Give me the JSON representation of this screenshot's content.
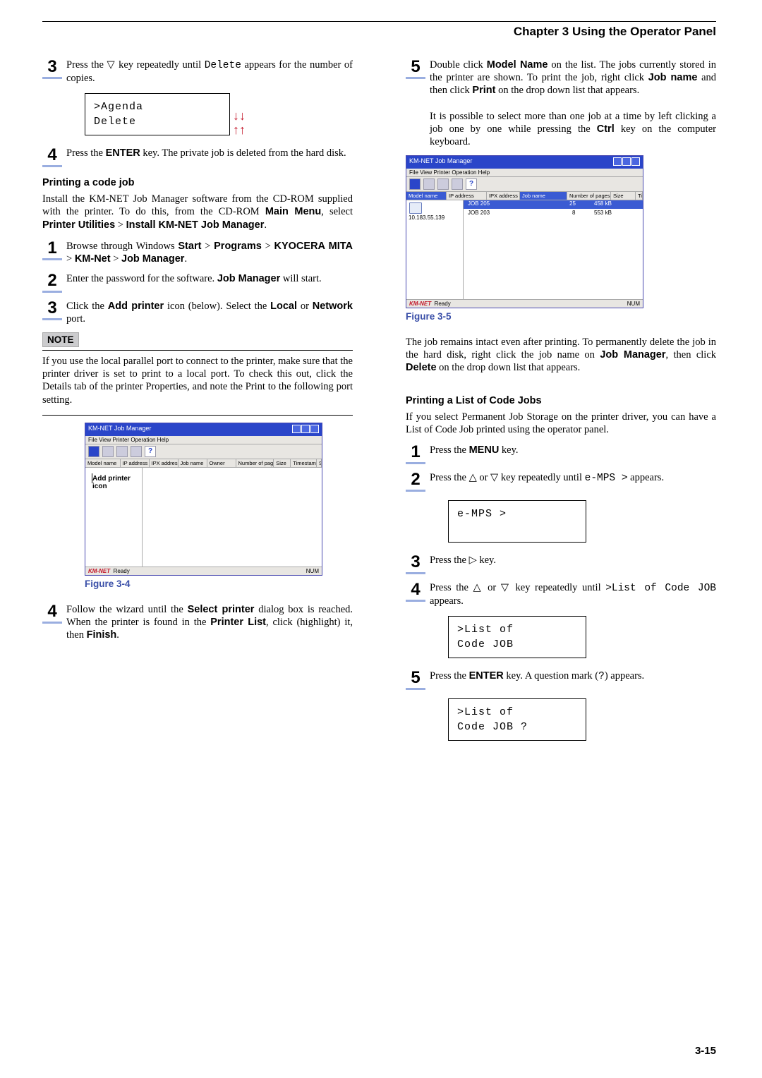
{
  "chapterTitle": "Chapter 3  Using the Operator Panel",
  "left": {
    "step3": "Press the ▽ key repeatedly until Delete appears for the number of copies.",
    "lcd3_line1": ">Agenda",
    "lcd3_line2": " Delete",
    "step4": "Press the ENTER key. The private job is deleted from the hard disk.",
    "sec_printingCodeJob": "Printing a code job",
    "para_install_full": "Install the KM-NET Job Manager software from the CD-ROM supplied with the printer. To do this, from the CD-ROM Main Menu, select Printer Utilities > Install KM-NET Job Manager.",
    "step1b_full": "Browse through Windows Start > Programs > KYOCERA MITA > KM-Net > Job Manager.",
    "step2b_full": "Enter the password for the software. Job Manager will start.",
    "step3b_full": "Click the Add printer icon (below). Select the Local or Network port.",
    "noteLabel": "NOTE",
    "noteBody": "If you use the local parallel port to connect to the printer, make sure that the printer driver is set to print to a local port. To check this out, click the Details tab of the printer Properties, and note the Print to the following port setting.",
    "figure34": "Figure 3-4",
    "step4b_full": "Follow the wizard until the Select printer dialog box is reached. When the printer is found in the Printer List, click (highlight) it, then Finish."
  },
  "right": {
    "step5_full": "Double click Model Name on the list. The jobs currently stored in the printer are shown. To print the job, right click Job name and then click Print on the drop down list that appears.",
    "step5_extra_full": "It is possible to select more than one job at a time by left clicking a job one by one while pressing the Ctrl key on the computer keyboard.",
    "figure35": "Figure 3-5",
    "after_fig_full": "The job remains intact even after printing. To permanently delete the job in the hard disk, right click the job name on Job Manager, then click Delete on the drop down list that appears.",
    "sec_listCodeJobs": "Printing a List of Code Jobs",
    "para_list": "If you select Permanent Job Storage on the printer driver, you can have a List of Code Job printed using the operator panel.",
    "r_step1_full": "Press the MENU key.",
    "r_step2": "Press the △ or ▽ key repeatedly until e-MPS > appears.",
    "lcd_emps": "e-MPS         >",
    "r_step3": "Press the ▷ key.",
    "r_step4": "Press the △ or ▽ key repeatedly until >List of Code JOB appears.",
    "lcd_list1_l1": ">List of",
    "lcd_list1_l2": " Code JOB",
    "r_step5_full": "Press the ENTER key. A question mark (?) appears.",
    "lcd_list2_l1": ">List of",
    "lcd_list2_l2": " Code JOB ?"
  },
  "screenshot": {
    "title": "KM-NET Job Manager",
    "menu": "File  View  Printer  Operation  Help",
    "cols_left": [
      "Model name",
      "IP address",
      "IPX address"
    ],
    "cols_right1": [
      "Job name",
      "Owner",
      "Number of pages",
      "Size",
      "Timestamp",
      "St"
    ],
    "cols_right2": [
      "Job name",
      "",
      "Number of pages",
      "Size",
      "Timestamp"
    ],
    "addPrinter": "Add printer\nicon",
    "statusReady": "Ready",
    "statusNum": "NUM",
    "brand": "KM-NET",
    "model_ip": "10.183.55.139",
    "job1": "JOB 205",
    "job1_pages": "25",
    "job1_size": "458 kB",
    "job2": "JOB 203",
    "job2_pages": "8",
    "job2_size": "553 kB"
  },
  "pageNumber": "3-15"
}
